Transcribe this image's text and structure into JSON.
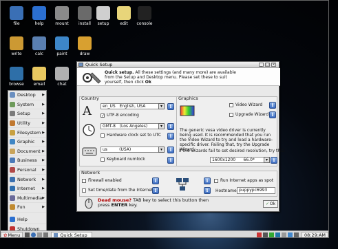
{
  "desktop_icons": [
    {
      "label": "file",
      "color": "#3a6fb5"
    },
    {
      "label": "help",
      "color": "#2b6fd0"
    },
    {
      "label": "mount",
      "color": "#8a8a8a"
    },
    {
      "label": "install",
      "color": "#6a6a6a"
    },
    {
      "label": "setup",
      "color": "#cfcfcf"
    },
    {
      "label": "edit",
      "color": "#e8d57a"
    },
    {
      "label": "console",
      "color": "#222222"
    },
    {
      "label": "write",
      "color": "#cc9933"
    },
    {
      "label": "calc",
      "color": "#5a7fb0"
    },
    {
      "label": "paint",
      "color": "#3d86c8"
    },
    {
      "label": "draw",
      "color": "#d8a030"
    },
    {
      "label": "browse",
      "color": "#2e6fa8"
    },
    {
      "label": "email",
      "color": "#e8c860"
    },
    {
      "label": "chat",
      "color": "#b0b0b0"
    }
  ],
  "start_menu": [
    {
      "label": "Desktop",
      "color": "#6a8fc0",
      "sub": true
    },
    {
      "label": "System",
      "color": "#6d9a5a",
      "sub": true
    },
    {
      "label": "Setup",
      "color": "#7a7a7a",
      "sub": true
    },
    {
      "label": "Utility",
      "color": "#c07830",
      "sub": true
    },
    {
      "label": "Filesystem",
      "color": "#c8a040",
      "sub": true
    },
    {
      "label": "Graphic",
      "color": "#3f86c4",
      "sub": true
    },
    {
      "label": "Document",
      "color": "#c9a45a",
      "sub": true
    },
    {
      "label": "Business",
      "color": "#4a7ab8",
      "sub": true
    },
    {
      "label": "Personal",
      "color": "#b04848",
      "sub": true
    },
    {
      "label": "Network",
      "color": "#3a70b0",
      "sub": true
    },
    {
      "label": "Internet",
      "color": "#2f6fb0",
      "sub": true
    },
    {
      "label": "Multimedia",
      "color": "#6a6a9a",
      "sub": true
    },
    {
      "label": "Fun",
      "color": "#c08a30",
      "sub": true
    },
    {
      "label": "Help",
      "color": "#2b6fd0",
      "sub": false
    },
    {
      "label": "Shutdown",
      "color": "#c03030",
      "sub": false
    }
  ],
  "taskbar": {
    "menu_label": "Menu",
    "window_button": "Quick Setup",
    "clock": "08:29:AM"
  },
  "dialog": {
    "title": "Quick Setup",
    "header_bold": "Quick setup.",
    "header_text": " All these settings (and many more) are available from the Setup and Desktop menu. Please set these to suit yourself, then click ",
    "header_ok": "Ok",
    "country": {
      "label": "Country",
      "locale_code": "en_US",
      "locale_name": "English, USA",
      "utf8_label": "UTF-8 encoding",
      "timezone_code": "GMT-8",
      "timezone_name": "(Los Angeles)",
      "hwclock_label": "Hardware clock set to UTC",
      "keyboard_code": "us",
      "keyboard_name": "(USA)",
      "numlock_label": "Keyboard numlock"
    },
    "graphics": {
      "label": "Graphics",
      "video_wizard": "Video Wizard",
      "upgrade_wizard": "Upgrade Wizard",
      "driver_text": "The generic vesa video driver is currently being used. It is recommended that you run the Video Wizard to try and load a hardware-specific driver. Failing that, try the Upgrade Wizard.",
      "fail_text": "If the Wizards fail to set desired resolution, try this:",
      "resolution": "1600x1200",
      "refresh": "66.0*"
    },
    "network": {
      "label": "Network",
      "firewall": "Firewall enabled",
      "set_time": "Set time/date from the Internet",
      "run_spot": "Run Internet apps as spot",
      "hostname_label": "Hostname:",
      "hostname_value": "puppypc6993"
    },
    "footer_bold": "Dead mouse?",
    "footer_text": " TAB key to select this button then press ",
    "footer_enter": "ENTER",
    "footer_end": " key.",
    "ok_button": "Ok"
  }
}
